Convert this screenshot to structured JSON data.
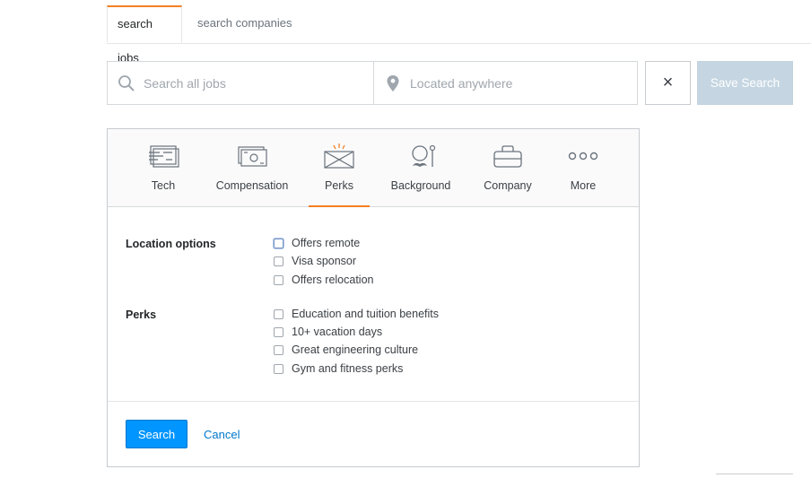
{
  "tabs": [
    {
      "label": "search jobs",
      "active": true
    },
    {
      "label": "search companies",
      "active": false
    }
  ],
  "search": {
    "jobs_placeholder": "Search all jobs",
    "location_placeholder": "Located anywhere",
    "clear_icon": "×",
    "save_label": "Save Search"
  },
  "categories": [
    {
      "label": "Tech",
      "icon": "tech-icon"
    },
    {
      "label": "Compensation",
      "icon": "compensation-icon"
    },
    {
      "label": "Perks",
      "icon": "perks-icon",
      "active": true
    },
    {
      "label": "Background",
      "icon": "background-icon"
    },
    {
      "label": "Company",
      "icon": "company-icon"
    },
    {
      "label": "More",
      "icon": "more-icon"
    }
  ],
  "groups": {
    "location": {
      "label": "Location options",
      "options": [
        "Offers remote",
        "Visa sponsor",
        "Offers relocation"
      ]
    },
    "perks": {
      "label": "Perks",
      "options": [
        "Education and tuition benefits",
        "10+ vacation days",
        "Great engineering culture",
        "Gym and fitness perks"
      ]
    }
  },
  "actions": {
    "search_label": "Search",
    "cancel_label": "Cancel"
  },
  "colors": {
    "accent": "#f48024",
    "primary": "#0095ff",
    "link": "#0077cc",
    "save_disabled": "#c5d6e2"
  }
}
